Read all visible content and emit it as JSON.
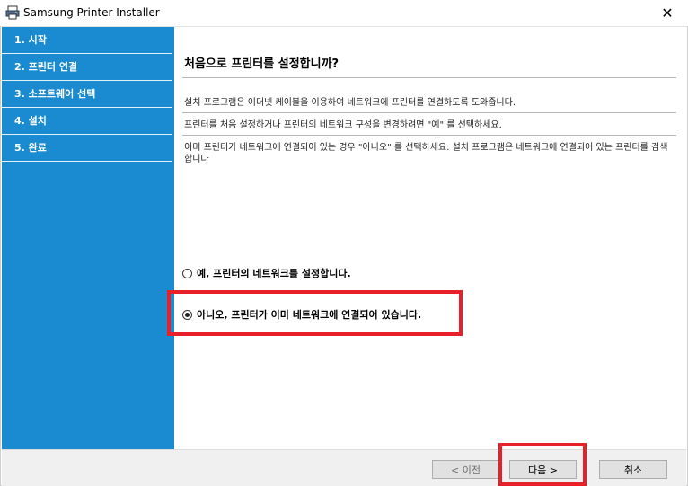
{
  "window": {
    "title": "Samsung Printer Installer",
    "close_glyph": "✕"
  },
  "sidebar": {
    "steps": [
      {
        "label": "1. 시작"
      },
      {
        "label": "2. 프린터 연결"
      },
      {
        "label": "3. 소프트웨어 선택"
      },
      {
        "label": "4. 설치"
      },
      {
        "label": "5. 완료"
      }
    ]
  },
  "main": {
    "heading": "처음으로 프린터를 설정합니까?",
    "paragraphs": [
      "설치 프로그램은 이더넷 케이블을 이용하여 네트워크에 프린터를 연결하도록 도와줍니다.",
      "프린터를 처음 설정하거나 프린터의 네트워크 구성을 변경하려면 \"예\" 를 선택하세요.",
      "이미 프린터가 네트워크에 연결되어 있는 경우 \"아니오\" 를 선택하세요. 설치 프로그램은 네트워크에 연결되어 있는 프린터를 검색합니다"
    ],
    "options": [
      {
        "label": "예, 프린터의 네트워크를 설정합니다.",
        "selected": false
      },
      {
        "label": "아니오, 프린터가 이미 네트워크에 연결되어 있습니다.",
        "selected": true
      }
    ]
  },
  "footer": {
    "back_label": "< 이전",
    "next_label": "다음 >",
    "cancel_label": "취소"
  },
  "colors": {
    "sidebar": "#1a8bd0",
    "highlight": "#e8202a"
  }
}
